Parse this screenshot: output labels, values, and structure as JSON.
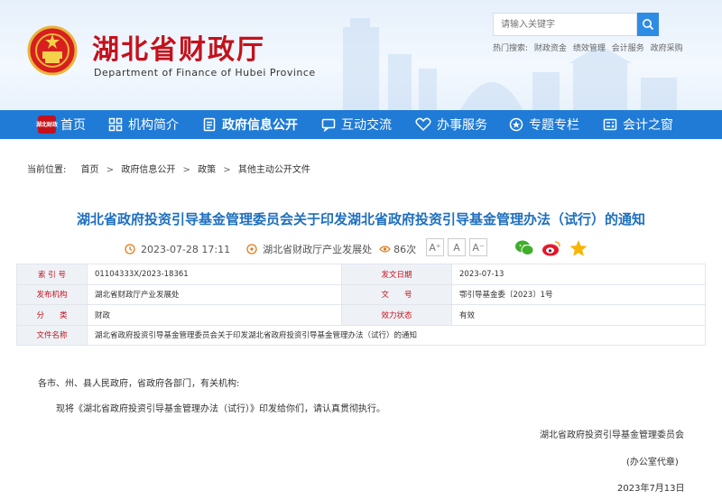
{
  "header": {
    "title": "湖北省财政厅",
    "subtitle": "Department of Finance of Hubei Province",
    "search_placeholder": "请输入关键字",
    "hot_label": "热门搜索:",
    "hot_terms": [
      "财政资金",
      "绩效管理",
      "会计服务",
      "政府采购"
    ]
  },
  "nav": {
    "home_logo": "湖北财政",
    "items": [
      {
        "label": "首页"
      },
      {
        "label": "机构简介"
      },
      {
        "label": "政府信息公开"
      },
      {
        "label": "互动交流"
      },
      {
        "label": "办事服务"
      },
      {
        "label": "专题专栏"
      },
      {
        "label": "会计之窗"
      }
    ]
  },
  "breadcrumb": {
    "prefix": "当前位置:",
    "items": [
      "首页",
      "政府信息公开",
      "政策",
      "其他主动公开文件"
    ]
  },
  "article": {
    "title": "湖北省政府投资引导基金管理委员会关于印发湖北省政府投资引导基金管理办法（试行）的通知",
    "datetime": "2023-07-28 17:11",
    "source": "湖北省财政厅产业发展处",
    "views": "86次",
    "font_sizes": [
      "A⁺",
      "A",
      "A⁻"
    ]
  },
  "info_table": {
    "index_label": "索 引 号",
    "index_value": "01104333X/2023-18361",
    "date_label": "发文日期",
    "date_value": "2023-07-13",
    "issuer_label": "发布机构",
    "issuer_value": "湖北省财政厅产业发展处",
    "docno_label": "文　　号",
    "docno_value": "鄂引导基金委〔2023〕1号",
    "category_label": "分　　类",
    "category_value": "财政",
    "status_label": "效力状态",
    "status_value": "有效",
    "filename_label": "文件名称",
    "filename_value": "湖北省政府投资引导基金管理委员会关于印发湖北省政府投资引导基金管理办法（试行）的通知"
  },
  "body": {
    "salutation": "各市、州、县人民政府，省政府各部门，有关机构:",
    "paragraph": "现将《湖北省政府投资引导基金管理办法（试行）》印发给你们，请认真贯彻执行。",
    "signature": "湖北省政府投资引导基金管理委员会",
    "seal_note": "(办公室代章)",
    "sign_date": "2023年7月13日"
  },
  "colors": {
    "brand_red": "#c4111b",
    "nav_blue": "#1f7bd6",
    "title_blue": "#1e6fbf"
  }
}
